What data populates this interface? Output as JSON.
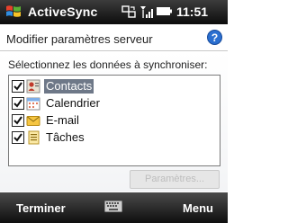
{
  "status_bar": {
    "app_title": "ActiveSync",
    "time": "11:51",
    "icons": [
      "windows-start-icon",
      "sync-icon",
      "signal-icon",
      "battery-icon"
    ]
  },
  "header": {
    "title": "Modifier paramètres serveur",
    "help_icon": "help-icon"
  },
  "content": {
    "instruction": "Sélectionnez les données à synchroniser:",
    "items": [
      {
        "label": "Contacts",
        "checked": true,
        "selected": true,
        "icon": "contacts-icon"
      },
      {
        "label": "Calendrier",
        "checked": true,
        "selected": false,
        "icon": "calendar-icon"
      },
      {
        "label": "E-mail",
        "checked": true,
        "selected": false,
        "icon": "email-icon"
      },
      {
        "label": "Tâches",
        "checked": true,
        "selected": false,
        "icon": "tasks-icon"
      }
    ],
    "settings_button": {
      "label": "Paramètres...",
      "enabled": false
    }
  },
  "softkeys": {
    "left": "Terminer",
    "right": "Menu",
    "center_icon": "keyboard-icon"
  },
  "colors": {
    "selection": "#6e7888",
    "bar_dark": "#1a1a1a",
    "help_blue": "#2a6fd0"
  }
}
